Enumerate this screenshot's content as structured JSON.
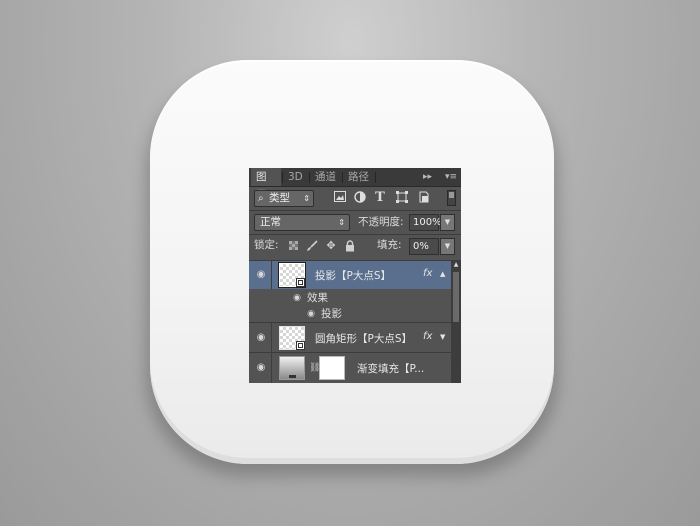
{
  "panel": {
    "tabs": [
      {
        "label": "图层",
        "active": true
      },
      {
        "label": "3D",
        "active": false
      },
      {
        "label": "通道",
        "active": false
      },
      {
        "label": "路径",
        "active": false
      }
    ],
    "menu_glyphs": {
      "collapse": "▸▸",
      "menu": "▾≡"
    },
    "filter": {
      "label": "类型",
      "icons": [
        "image-filter-icon",
        "adjustment-filter-icon",
        "type-filter-icon",
        "shape-filter-icon",
        "smart-object-filter-icon"
      ],
      "type_glyph": "T"
    },
    "blend": {
      "mode": "正常",
      "opacity_label": "不透明度:",
      "opacity_value": "100%"
    },
    "lock": {
      "label": "锁定:",
      "fill_label": "填充:",
      "fill_value": "0%"
    },
    "layers": [
      {
        "name": "投影【P大点S】",
        "selected": true,
        "fx": "fx",
        "effects_label": "效果",
        "effects": [
          "投影"
        ]
      },
      {
        "name": "圆角矩形【P大点S】",
        "selected": false,
        "fx": "fx"
      },
      {
        "name": "渐变填充【P...",
        "selected": false
      }
    ]
  },
  "colors": {
    "panel_bg": "#535353",
    "tabbar_bg": "#3a3a3a",
    "selected_row": "#5a6f8e",
    "icon_white": "#f3f3f3"
  }
}
